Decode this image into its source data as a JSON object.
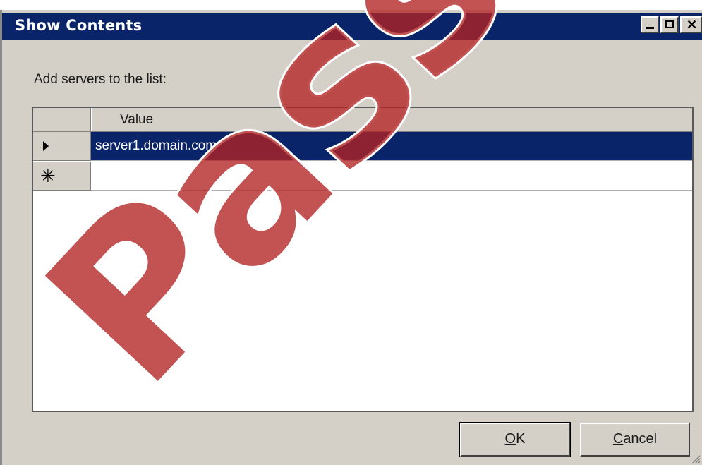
{
  "window": {
    "title": "Show Contents"
  },
  "prompt": "Add servers to the list:",
  "grid": {
    "column_header": "Value",
    "rows": [
      {
        "indicator": "current-row",
        "value": "server1.domain.com",
        "selected": true
      },
      {
        "indicator": "new-row",
        "value": ""
      }
    ]
  },
  "buttons": {
    "ok_mnemonic": "O",
    "ok_rest": "K",
    "cancel_mnemonic": "C",
    "cancel_rest": "ancel"
  },
  "watermark": {
    "text": "PassA",
    "color": "#b22222"
  },
  "colors": {
    "titlebar": "#0a246a",
    "selection": "#0a246a",
    "dialog_face": "#d4d0c8"
  }
}
